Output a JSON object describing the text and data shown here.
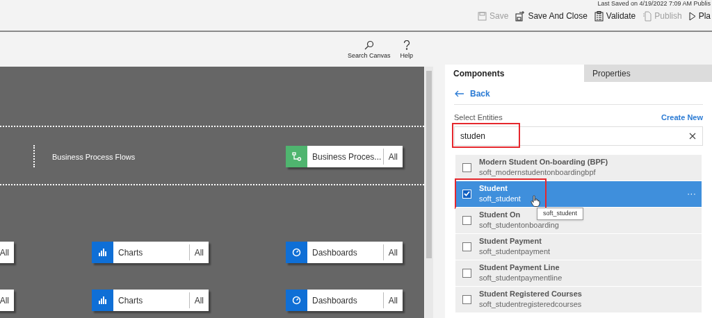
{
  "header": {
    "last_saved": "Last Saved on 4/19/2022 7:09 AM Publis",
    "commands": [
      {
        "label": "Save",
        "kind": "save",
        "disabled": true
      },
      {
        "label": "Save And Close",
        "kind": "saveclose",
        "disabled": false
      },
      {
        "label": "Validate",
        "kind": "validate",
        "disabled": false
      },
      {
        "label": "Publish",
        "kind": "publish",
        "disabled": true
      },
      {
        "label": "Pla",
        "kind": "play",
        "disabled": false
      }
    ]
  },
  "toolbar": [
    {
      "label": "Search Canvas",
      "kind": "search"
    },
    {
      "label": "Help",
      "kind": "help"
    }
  ],
  "canvas": {
    "section_label": "Business Process Flows",
    "tiles": [
      {
        "kind": "bpf",
        "label": "Business Proces...",
        "scope": "All"
      },
      {
        "kind": "partial",
        "scope": "All"
      },
      {
        "kind": "chart",
        "label": "Charts",
        "scope": "All"
      },
      {
        "kind": "dashboard",
        "label": "Dashboards",
        "scope": "All"
      },
      {
        "kind": "partial",
        "scope": "All"
      },
      {
        "kind": "chart",
        "label": "Charts",
        "scope": "All"
      },
      {
        "kind": "dashboard",
        "label": "Dashboards",
        "scope": "All"
      }
    ]
  },
  "panel": {
    "tabs": [
      {
        "label": "Components",
        "selected": true
      },
      {
        "label": "Properties",
        "selected": false
      }
    ],
    "back": "Back",
    "heading": "Select Entities",
    "create_new": "Create New",
    "search": {
      "value": "studen",
      "highlighted": true
    },
    "entities": [
      {
        "name": "Modern Student On-boarding (BPF)",
        "logical": "soft_modernstudentonboardingbpf",
        "checked": false,
        "selected": false,
        "highlighted": false
      },
      {
        "name": "Student",
        "logical": "soft_student",
        "checked": true,
        "selected": true,
        "highlighted": true,
        "more": "···"
      },
      {
        "name": "Student On",
        "logical": "soft_studentonboarding",
        "checked": false,
        "selected": false,
        "highlighted": false
      },
      {
        "name": "Student Payment",
        "logical": "soft_studentpayment",
        "checked": false,
        "selected": false,
        "highlighted": false
      },
      {
        "name": "Student Payment Line",
        "logical": "soft_studentpaymentline",
        "checked": false,
        "selected": false,
        "highlighted": false
      },
      {
        "name": "Student Registered Courses",
        "logical": "soft_studentregisteredcourses",
        "checked": false,
        "selected": false,
        "highlighted": false
      }
    ],
    "tooltip": "soft_student"
  }
}
